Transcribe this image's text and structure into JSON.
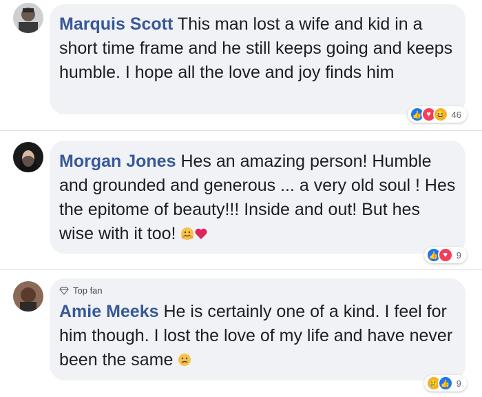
{
  "comments": [
    {
      "author": "Marquis Scott",
      "text": "This man lost a wife and kid in a short time frame and he still keeps going and keeps humble. I hope all the love and joy finds him",
      "top_fan": null,
      "reactions": [
        "like",
        "love",
        "haha"
      ],
      "reaction_count": "46"
    },
    {
      "author": "Morgan Jones",
      "text": "Hes an amazing person! Humble and grounded and generous ... a very old soul ! Hes the epitome of beauty!!! Inside and out! But hes wise with it too!",
      "top_fan": null,
      "inline_emojis": [
        "hug-face",
        "red-heart"
      ],
      "reactions": [
        "like",
        "love"
      ],
      "reaction_count": "9"
    },
    {
      "author": "Amie Meeks",
      "text": "He is certainly one of a kind. I feel for him though. I lost the love of my life and have never been the same",
      "top_fan": "Top fan",
      "inline_emojis": [
        "sad-face"
      ],
      "reactions": [
        "sad",
        "like"
      ],
      "reaction_count": "9"
    }
  ]
}
